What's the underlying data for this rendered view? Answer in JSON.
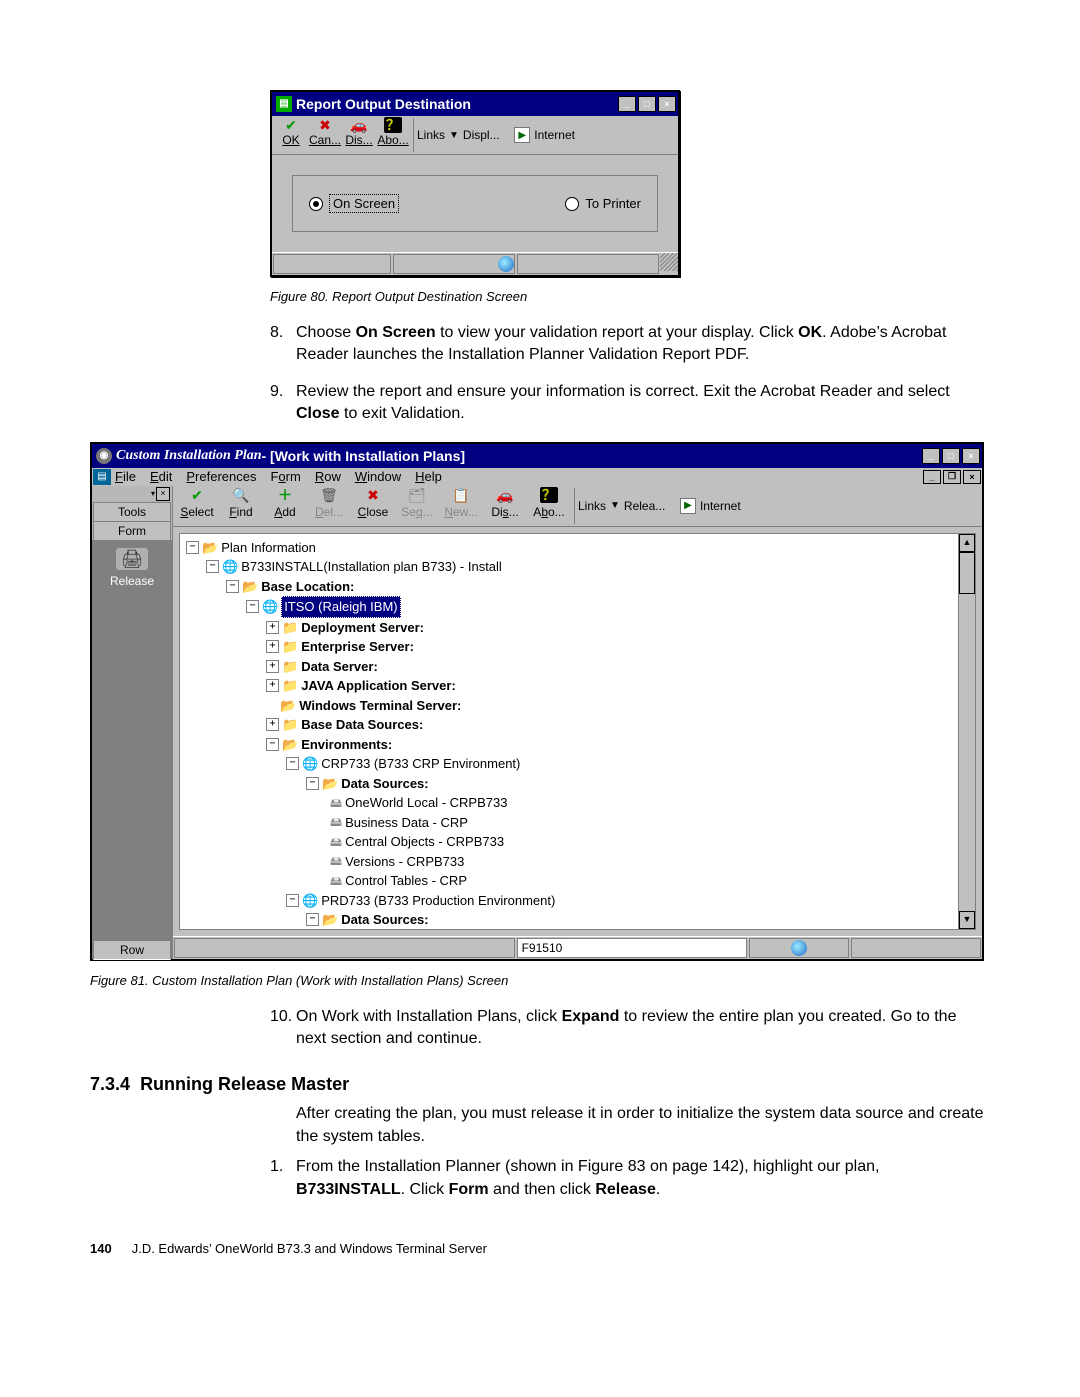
{
  "fig80": {
    "title": "Report Output Destination",
    "btn_ok": "OK",
    "btn_cancel": "Can...",
    "btn_dis": "Dis...",
    "btn_abo": "Abo...",
    "links": "Links",
    "displ": "Displ...",
    "internet": "Internet",
    "radio_onscreen": "On Screen",
    "radio_toprinter": "To Printer",
    "caption": "Figure 80.  Report Output Destination Screen"
  },
  "step8": {
    "num": "8.",
    "pre": "Choose ",
    "bold1": "On Screen",
    "mid": " to view your validation report at your display. Click ",
    "bold2": "OK",
    "post": ". Adobe’s Acrobat Reader launches the Installation Planner Validation Report PDF."
  },
  "step9": {
    "num": "9.",
    "pre": "Review the report and ensure your information is correct. Exit the Acrobat Reader and select ",
    "bold1": "Close",
    "post": " to exit Validation."
  },
  "fig81": {
    "title_app": "Custom Installation Plan",
    "title_doc": "  - [Work with Installation Plans]",
    "menu": {
      "file": "File",
      "edit": "Edit",
      "pref": "Preferences",
      "form": "Form",
      "row": "Row",
      "window": "Window",
      "help": "Help"
    },
    "sidebar": {
      "tools": "Tools",
      "form": "Form",
      "release": "Release",
      "row_tab": "Row"
    },
    "toolbar": {
      "select": "Select",
      "find": "Find",
      "add": "Add",
      "del": "Del...",
      "close": "Close",
      "seq": "Seq...",
      "new": "New...",
      "dis": "Dis...",
      "abo": "Abo...",
      "links": "Links",
      "relea": "Relea...",
      "internet": "Internet"
    },
    "tree": {
      "plan_info": "Plan Information",
      "b733": "B733INSTALL(Installation plan B733) - Install",
      "base_loc": "Base Location:",
      "itso": "ITSO (Raleigh IBM)",
      "dep": "Deployment Server:",
      "ent": "Enterprise Server:",
      "data": "Data Server:",
      "java": "JAVA Application Server:",
      "wts": "Windows Terminal Server:",
      "bds": "Base Data Sources:",
      "env": "Environments:",
      "crp": "CRP733 (B733 CRP Environment)",
      "ds": "Data Sources:",
      "owl": "OneWorld Local - CRPB733",
      "bdata": "Business Data - CRP",
      "cobj": "Central Objects - CRPB733",
      "vers": "Versions - CRPB733",
      "ctrl": "Control Tables - CRP",
      "prd": "PRD733 (B733 Production Environment)",
      "ds2": "Data Sources:"
    },
    "status_code": "F91510",
    "caption": "Figure 81.  Custom Installation Plan (Work with Installation Plans) Screen"
  },
  "step10": {
    "num": "10.",
    "pre": "On Work with Installation Plans, click ",
    "bold1": "Expand",
    "post": " to review the entire plan you created. Go to the next section and continue."
  },
  "sect": {
    "num": "7.3.4",
    "title": "Running Release Master"
  },
  "sect_intro": "After creating the plan, you must release it in order to initialize the system data source and create the system tables.",
  "step1": {
    "num": "1.",
    "pre": "From the Installation Planner (shown in Figure 83 on page 142), highlight our plan, ",
    "bold1": "B733INSTALL",
    "mid": ". Click ",
    "bold2": "Form",
    "mid2": " and then click ",
    "bold3": "Release",
    "post": "."
  },
  "footer": {
    "page": "140",
    "title": "J.D. Edwards’ OneWorld B73.3 and Windows Terminal Server"
  }
}
